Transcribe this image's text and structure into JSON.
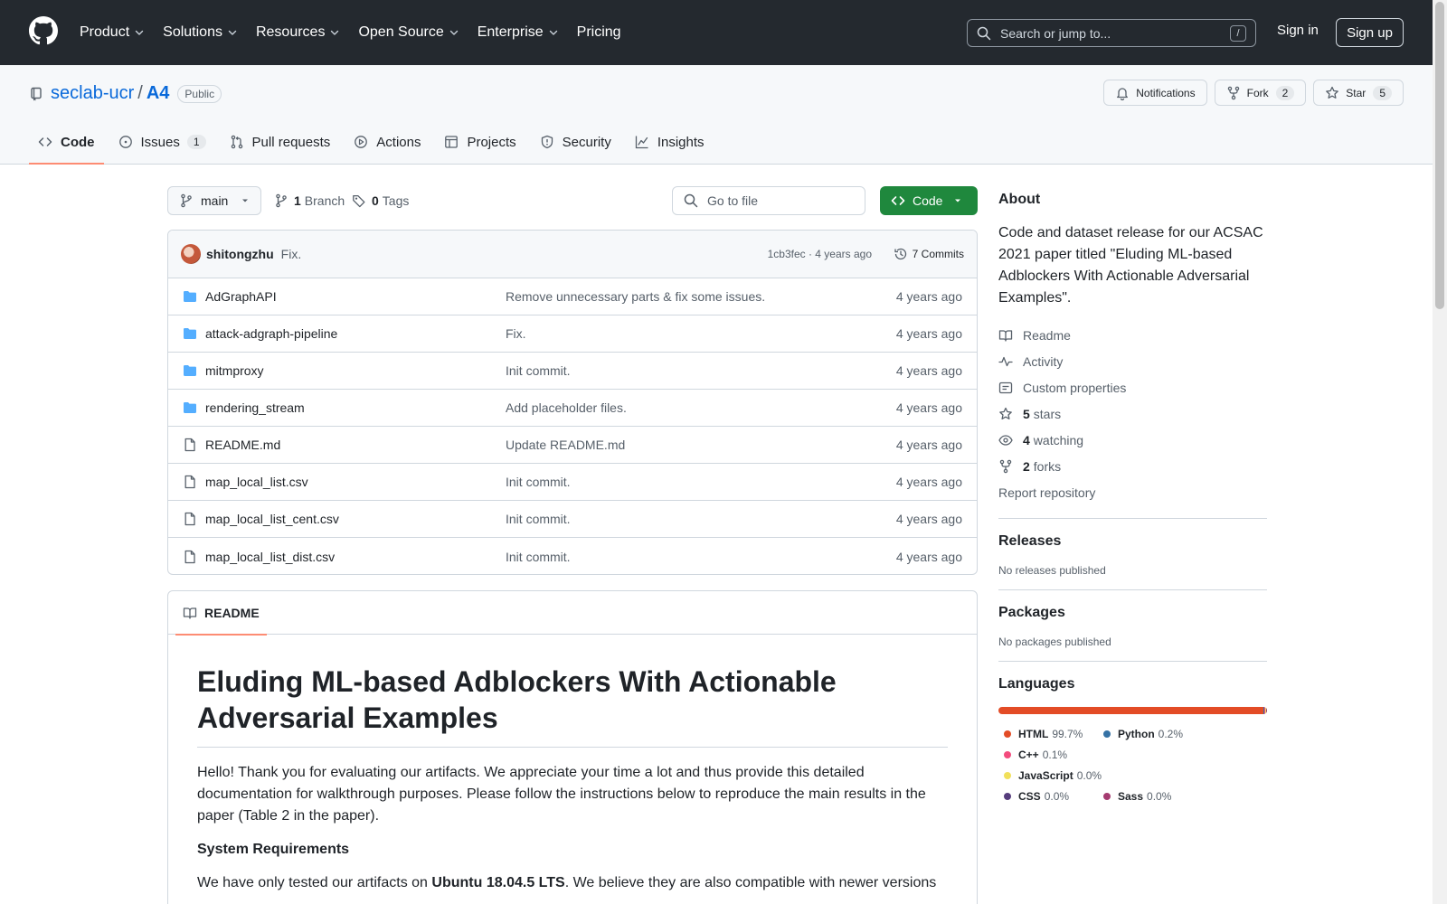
{
  "header": {
    "nav": [
      "Product",
      "Solutions",
      "Resources",
      "Open Source",
      "Enterprise",
      "Pricing"
    ],
    "search_placeholder": "Search or jump to...",
    "search_key": "/",
    "sign_in": "Sign in",
    "sign_up": "Sign up"
  },
  "repo": {
    "owner": "seclab-ucr",
    "separator": "/",
    "name": "A4",
    "visibility": "Public",
    "notifications_label": "Notifications",
    "fork_label": "Fork",
    "fork_count": "2",
    "star_label": "Star",
    "star_count": "5"
  },
  "tabs": [
    {
      "label": "Code",
      "icon": "code-icon"
    },
    {
      "label": "Issues",
      "icon": "issue-icon",
      "count": "1"
    },
    {
      "label": "Pull requests",
      "icon": "pull-request-icon"
    },
    {
      "label": "Actions",
      "icon": "play-icon"
    },
    {
      "label": "Projects",
      "icon": "table-icon"
    },
    {
      "label": "Security",
      "icon": "shield-icon"
    },
    {
      "label": "Insights",
      "icon": "graph-icon"
    }
  ],
  "filebar": {
    "branch": "main",
    "branch_count": "1",
    "branch_label": "Branch",
    "tag_count": "0",
    "tag_label": "Tags",
    "goto_placeholder": "Go to file",
    "code_button": "Code"
  },
  "latest_commit": {
    "author": "shitongzhu",
    "message": "Fix.",
    "meta": "1cb3fec · 4 years ago",
    "commits_label": "7 Commits"
  },
  "files": [
    {
      "name": "AdGraphAPI",
      "type": "dir",
      "message": "Remove unnecessary parts & fix some issues.",
      "age": "4 years ago"
    },
    {
      "name": "attack-adgraph-pipeline",
      "type": "dir",
      "message": "Fix.",
      "age": "4 years ago"
    },
    {
      "name": "mitmproxy",
      "type": "dir",
      "message": "Init commit.",
      "age": "4 years ago"
    },
    {
      "name": "rendering_stream",
      "type": "dir",
      "message": "Add placeholder files.",
      "age": "4 years ago"
    },
    {
      "name": "README.md",
      "type": "file",
      "message": "Update README.md",
      "age": "4 years ago"
    },
    {
      "name": "map_local_list.csv",
      "type": "file",
      "message": "Init commit.",
      "age": "4 years ago"
    },
    {
      "name": "map_local_list_cent.csv",
      "type": "file",
      "message": "Init commit.",
      "age": "4 years ago"
    },
    {
      "name": "map_local_list_dist.csv",
      "type": "file",
      "message": "Init commit.",
      "age": "4 years ago"
    }
  ],
  "readme": {
    "tab_label": "README",
    "title": "Eluding ML-based Adblockers With Actionable Adversarial Examples",
    "intro": "Hello! Thank you for evaluating our artifacts. We appreciate your time a lot and thus provide this detailed documentation for walkthrough purposes. Please follow the instructions below to reproduce the main results in the paper (Table 2 in the paper).",
    "section_heading": "System Requirements",
    "req_prefix": "We have only tested our artifacts on ",
    "req_bold": "Ubuntu 18.04.5 LTS",
    "req_suffix": ". We believe they are also compatible with newer versions"
  },
  "about": {
    "heading": "About",
    "description": "Code and dataset release for our ACSAC 2021 paper titled \"Eluding ML-based Adblockers With Actionable Adversarial Examples\".",
    "readme": "Readme",
    "activity": "Activity",
    "custom_properties": "Custom properties",
    "stars_count": "5",
    "stars_label": "stars",
    "watching_count": "4",
    "watching_label": "watching",
    "forks_count": "2",
    "forks_label": "forks",
    "report": "Report repository"
  },
  "releases": {
    "heading": "Releases",
    "text": "No releases published"
  },
  "packages": {
    "heading": "Packages",
    "text": "No packages published"
  },
  "languages": {
    "heading": "Languages",
    "items": [
      {
        "name": "HTML",
        "percent": "99.7%",
        "color": "#e34c26",
        "share": 99.7
      },
      {
        "name": "Python",
        "percent": "0.2%",
        "color": "#3572A5",
        "share": 0.2
      },
      {
        "name": "C++",
        "percent": "0.1%",
        "color": "#f34b7d",
        "share": 0.1
      },
      {
        "name": "JavaScript",
        "percent": "0.0%",
        "color": "#f1e05a",
        "share": 0.0
      },
      {
        "name": "CSS",
        "percent": "0.0%",
        "color": "#563d7c",
        "share": 0.0
      },
      {
        "name": "Sass",
        "percent": "0.0%",
        "color": "#a53b70",
        "share": 0.0
      }
    ]
  },
  "colors": {
    "header_bg": "#24292f",
    "link": "#0969da",
    "primary_button": "#1f883d",
    "tab_underline": "#fd8c73",
    "folder": "#54aeff"
  }
}
